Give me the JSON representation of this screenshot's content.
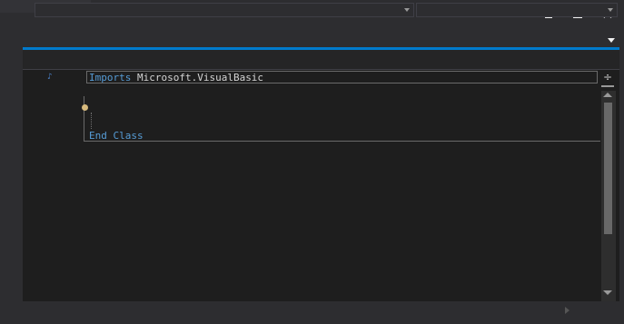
{
  "window": {
    "min_icon": "minimize-icon",
    "max_icon": "maximize-icon",
    "close_icon": "close-icon",
    "close_glyph": "✕",
    "menu_icon": "dropdown-triangle-icon"
  },
  "navigation_bar": {
    "left_dropdown_icon": "chevron-down-icon",
    "right_dropdown_icon": "chevron-down-icon"
  },
  "editor": {
    "lines": [
      {
        "keyword": "Imports",
        "text": " Microsoft.VisualBasic"
      },
      {
        "keyword": "End Class",
        "text": ""
      }
    ],
    "split_glyph": "÷",
    "split_icon": "split-window-icon"
  },
  "colors": {
    "accent": "#007acc",
    "editor_background": "#1e1e1e",
    "keyword": "#569cd6",
    "text": "#d4d4d4"
  }
}
